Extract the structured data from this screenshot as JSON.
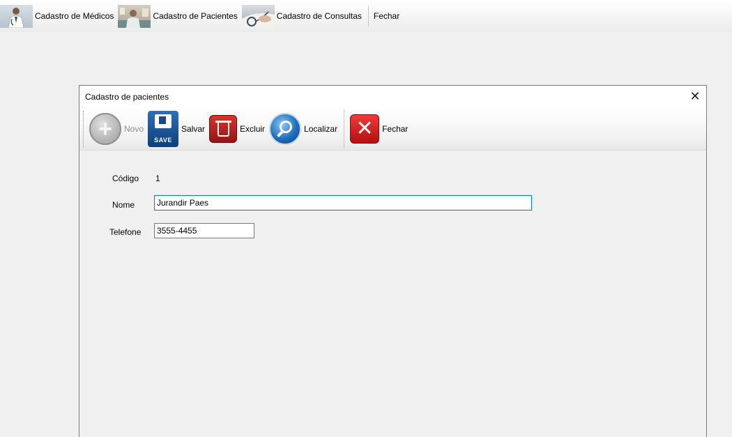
{
  "menu": {
    "items": [
      {
        "label": "Cadastro de Médicos",
        "icon": "doctor-photo-icon"
      },
      {
        "label": "Cadastro de Pacientes",
        "icon": "patient-photo-icon"
      },
      {
        "label": "Cadastro de Consultas",
        "icon": "consultation-photo-icon"
      }
    ],
    "close_label": "Fechar"
  },
  "window": {
    "title": "Cadastro de pacientes",
    "close_glyph": "✕"
  },
  "toolbar": {
    "novo_label": "Novo",
    "salvar_label": "Salvar",
    "save_icon_text": "SAVE",
    "excluir_label": "Excluir",
    "localizar_label": "Localizar",
    "fechar_label": "Fechar"
  },
  "form": {
    "codigo_label": "Código",
    "codigo_value": "1",
    "nome_label": "Nome",
    "nome_value": "Jurandir Paes",
    "telefone_label": "Telefone",
    "telefone_value": "3555-4455"
  },
  "colors": {
    "background": "#f0f0f0",
    "focus_border": "#0078d7"
  }
}
